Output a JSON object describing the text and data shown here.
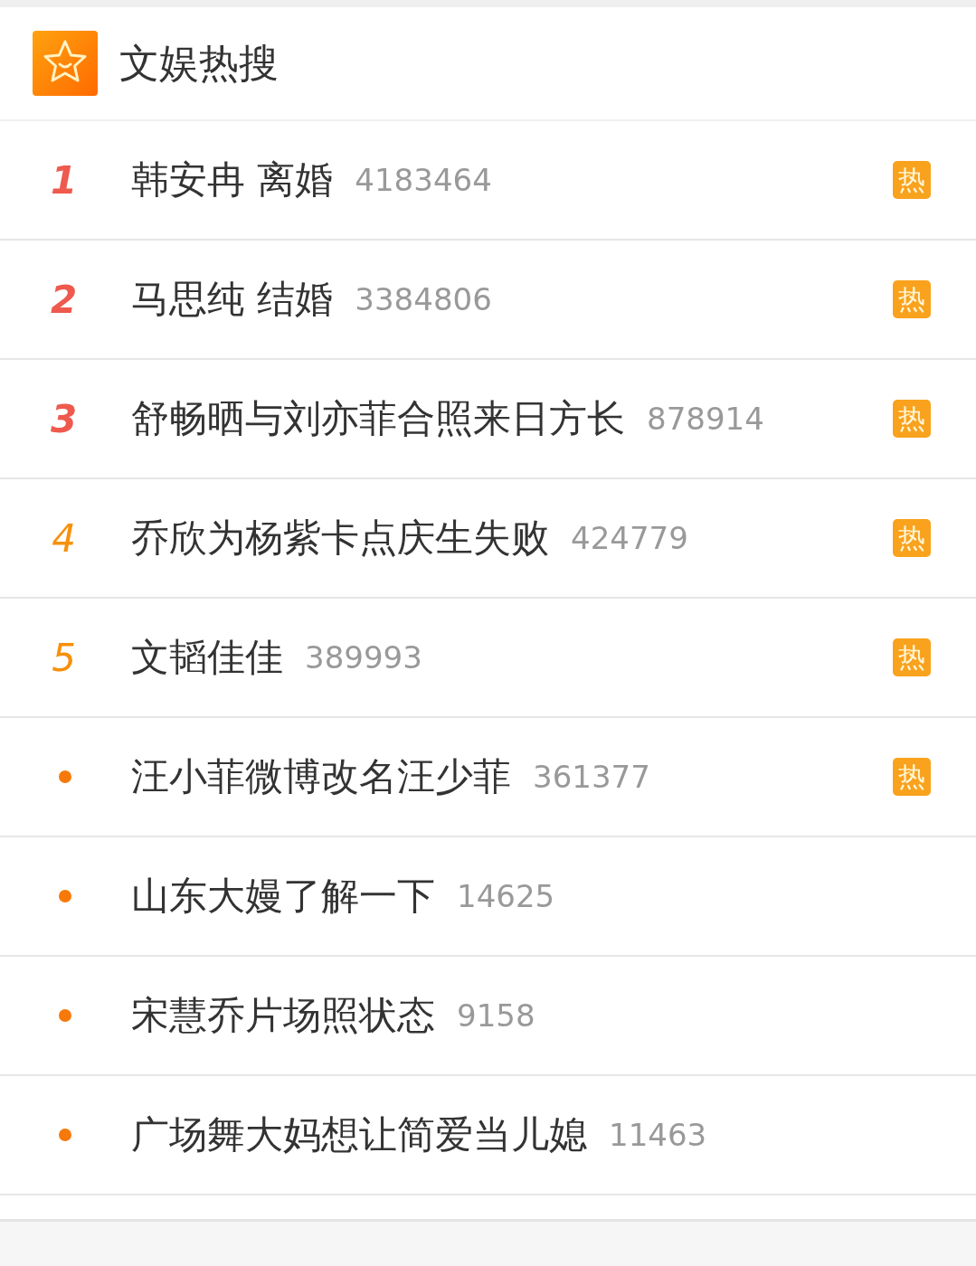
{
  "header": {
    "title": "文娱热搜"
  },
  "items": [
    {
      "kind": "top",
      "rank": "1",
      "title": "韩安冉 离婚",
      "count": "4183464",
      "badge": "热"
    },
    {
      "kind": "top",
      "rank": "2",
      "title": "马思纯 结婚",
      "count": "3384806",
      "badge": "热"
    },
    {
      "kind": "top",
      "rank": "3",
      "title": "舒畅晒与刘亦菲合照来日方长",
      "count": "878914",
      "badge": "热"
    },
    {
      "kind": "rank",
      "rank": "4",
      "title": "乔欣为杨紫卡点庆生失败",
      "count": "424779",
      "badge": "热"
    },
    {
      "kind": "rank",
      "rank": "5",
      "title": "文韬佳佳",
      "count": "389993",
      "badge": "热"
    },
    {
      "kind": "dot",
      "title": "汪小菲微博改名汪少菲",
      "count": "361377",
      "badge": "热"
    },
    {
      "kind": "dot",
      "title": "山东大嫚了解一下",
      "count": "14625"
    },
    {
      "kind": "dot",
      "title": "宋慧乔片场照状态",
      "count": "9158"
    },
    {
      "kind": "dot",
      "title": "广场舞大妈想让简爱当儿媳",
      "count": "11463"
    }
  ]
}
